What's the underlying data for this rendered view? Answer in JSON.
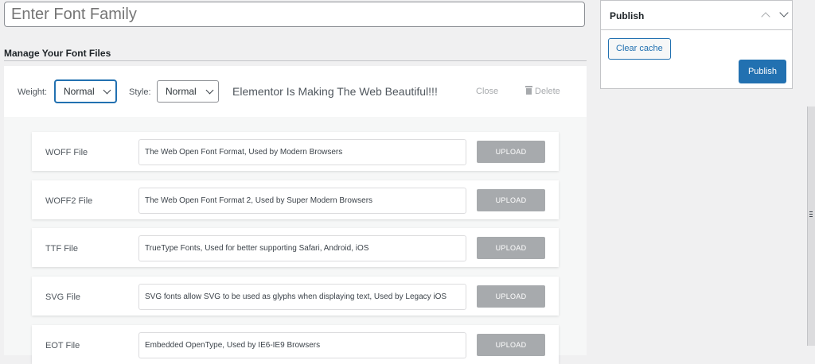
{
  "font_family": {
    "placeholder": "Enter Font Family"
  },
  "section": {
    "title": "Manage Your Font Files"
  },
  "toolbar": {
    "weight_label": "Weight:",
    "weight_value": "Normal",
    "style_label": "Style:",
    "style_value": "Normal",
    "preview_text": "Elementor Is Making The Web Beautiful!!!",
    "close_label": "Close",
    "delete_label": "Delete"
  },
  "files": [
    {
      "label": "WOFF File",
      "description": "The Web Open Font Format, Used by Modern Browsers",
      "button": "UPLOAD"
    },
    {
      "label": "WOFF2 File",
      "description": "The Web Open Font Format 2, Used by Super Modern Browsers",
      "button": "UPLOAD"
    },
    {
      "label": "TTF File",
      "description": "TrueType Fonts, Used for better supporting Safari, Android, iOS",
      "button": "UPLOAD"
    },
    {
      "label": "SVG File",
      "description": "SVG fonts allow SVG to be used as glyphs when displaying text, Used by Legacy iOS",
      "button": "UPLOAD"
    },
    {
      "label": "EOT File",
      "description": "Embedded OpenType, Used by IE6-IE9 Browsers",
      "button": "UPLOAD"
    }
  ],
  "publish": {
    "title": "Publish",
    "clear_cache": "Clear cache",
    "publish_button": "Publish"
  },
  "colors": {
    "accent": "#2271b1",
    "upload_button": "#a7aaad",
    "background": "#f0f0f1"
  },
  "icons": [
    "chevron-down-icon",
    "trash-icon",
    "arrow-up-icon",
    "arrow-down-icon"
  ]
}
